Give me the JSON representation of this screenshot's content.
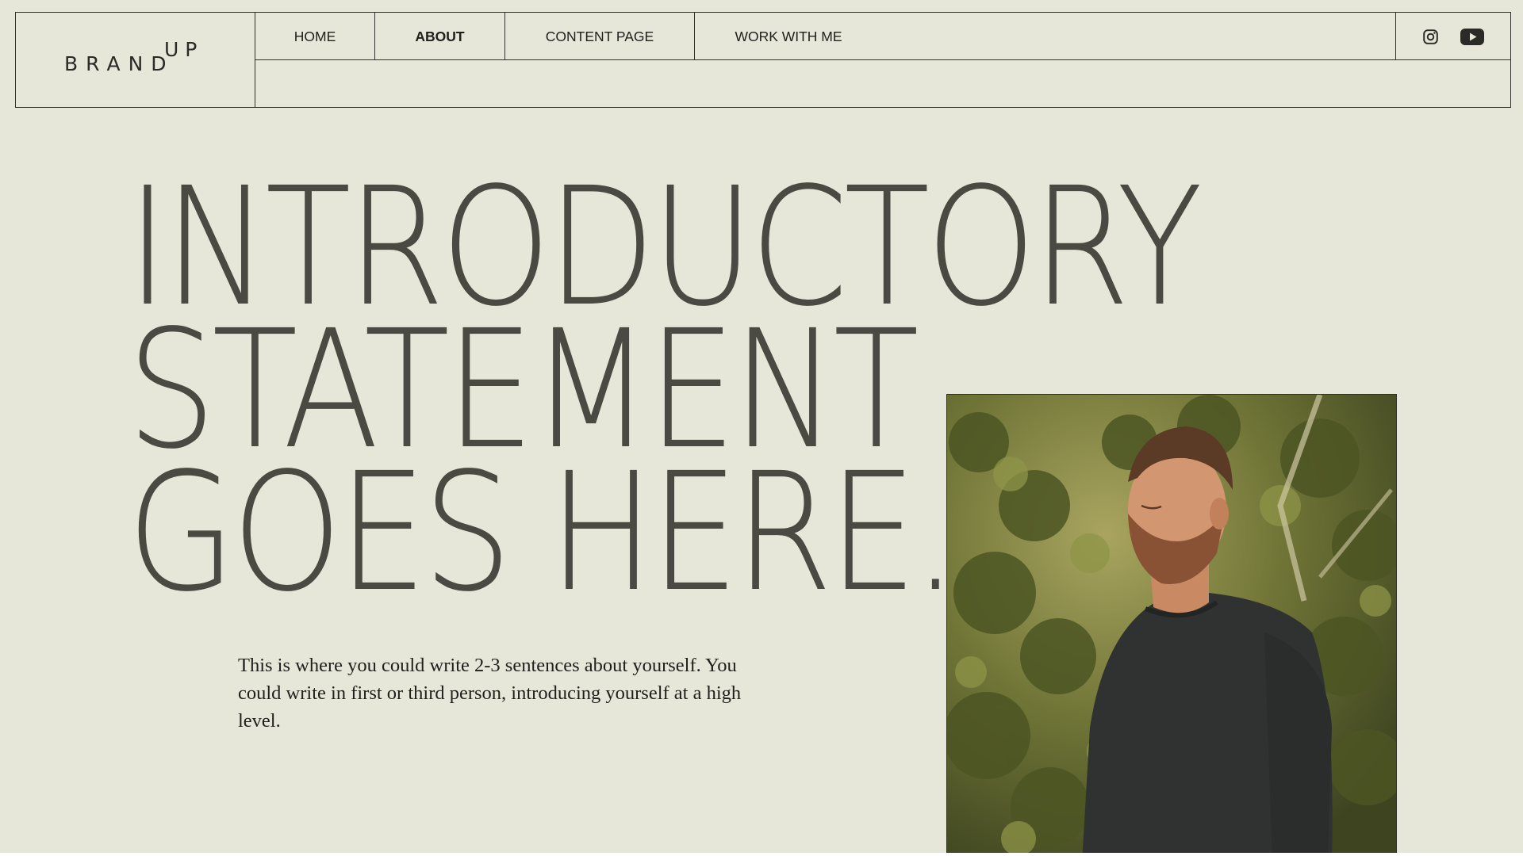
{
  "brand": {
    "name": "BRAND",
    "suffix": "UP"
  },
  "nav": {
    "items": [
      {
        "label": "HOME",
        "active": false
      },
      {
        "label": "ABOUT",
        "active": true
      },
      {
        "label": "CONTENT PAGE",
        "active": false
      },
      {
        "label": "WORK WITH ME",
        "active": false
      }
    ]
  },
  "social": {
    "icons": [
      "instagram-icon",
      "youtube-icon"
    ]
  },
  "hero": {
    "headline_lines": [
      "INTRODUCTORY",
      "STATEMENT",
      "GOES HERE."
    ],
    "intro_text": "This is where you could write 2-3 sentences about yourself. You could write in first or third person, introducing yourself at a high level."
  },
  "photo": {
    "subject": "portrait-photo"
  },
  "colors": {
    "background": "#e6e6d9",
    "text": "#4a4a42",
    "border": "#2f2f2b"
  }
}
